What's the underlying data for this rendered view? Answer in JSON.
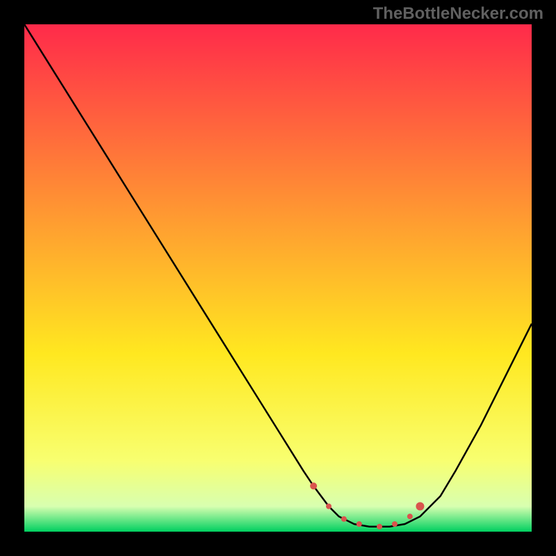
{
  "watermark": "TheBottleNecker.com",
  "chart_data": {
    "type": "line",
    "title": "",
    "xlabel": "",
    "ylabel": "",
    "xlim": [
      0,
      100
    ],
    "ylim": [
      0,
      100
    ],
    "gradient_stops": [
      {
        "offset": 0,
        "color": "#ff2a4a"
      },
      {
        "offset": 40,
        "color": "#ffa030"
      },
      {
        "offset": 65,
        "color": "#ffe820"
      },
      {
        "offset": 86,
        "color": "#f8ff70"
      },
      {
        "offset": 95,
        "color": "#d8ffb0"
      },
      {
        "offset": 100,
        "color": "#00d060"
      }
    ],
    "series": [
      {
        "name": "bottleneck-curve",
        "color": "#000000",
        "x": [
          0,
          5,
          10,
          15,
          20,
          25,
          30,
          35,
          40,
          45,
          50,
          55,
          57,
          60,
          62,
          65,
          68,
          70,
          72,
          75,
          78,
          82,
          85,
          90,
          95,
          100
        ],
        "y": [
          100,
          92,
          84,
          76,
          68,
          60,
          52,
          44,
          36,
          28,
          20,
          12,
          9,
          5,
          3,
          1.5,
          1,
          1,
          1,
          1.5,
          3,
          7,
          12,
          21,
          31,
          41
        ]
      }
    ],
    "markers": [
      {
        "name": "sweet-spot-start",
        "x": 57,
        "y": 9,
        "r": 5,
        "color": "#d9544d"
      },
      {
        "name": "sweet-spot-left",
        "x": 60,
        "y": 5,
        "r": 4,
        "color": "#d9544d"
      },
      {
        "name": "sweet-spot-mid1",
        "x": 63,
        "y": 2.5,
        "r": 4,
        "color": "#d9544d"
      },
      {
        "name": "sweet-spot-mid2",
        "x": 66,
        "y": 1.5,
        "r": 4,
        "color": "#d9544d"
      },
      {
        "name": "sweet-spot-mid3",
        "x": 70,
        "y": 1,
        "r": 4,
        "color": "#d9544d"
      },
      {
        "name": "sweet-spot-mid4",
        "x": 73,
        "y": 1.5,
        "r": 4,
        "color": "#d9544d"
      },
      {
        "name": "sweet-spot-right",
        "x": 76,
        "y": 3,
        "r": 4,
        "color": "#d9544d"
      },
      {
        "name": "sweet-spot-end",
        "x": 78,
        "y": 5,
        "r": 6,
        "color": "#d9544d"
      }
    ]
  }
}
